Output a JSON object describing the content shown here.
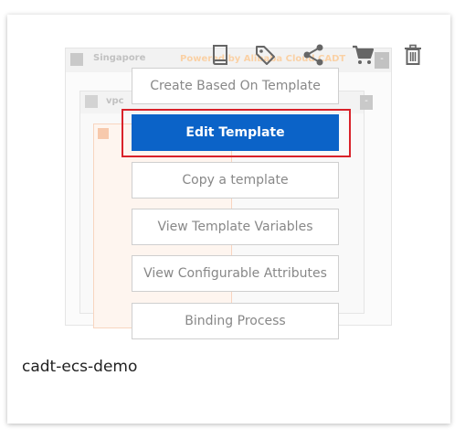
{
  "diagram": {
    "region_label": "Singapore",
    "powered_by": "Powered by Alibaba Cloud CADT",
    "vpc_label": "vpc",
    "collapse_symbol": "-"
  },
  "toolbar": {
    "icons": [
      "book-icon",
      "tag-icon",
      "share-icon",
      "cart-icon",
      "trash-icon"
    ]
  },
  "menu": {
    "items": [
      {
        "label": "Create Based On Template"
      },
      {
        "label": "Edit Template",
        "highlighted": true
      },
      {
        "label": "Copy a template"
      },
      {
        "label": "View Template Variables"
      },
      {
        "label": "View Configurable Attributes"
      },
      {
        "label": "Binding Process"
      }
    ]
  },
  "card": {
    "name": "cadt-ecs-demo"
  },
  "colors": {
    "primary": "#0b63c8",
    "highlight_border": "#d9222a",
    "button_text": "#888888"
  }
}
